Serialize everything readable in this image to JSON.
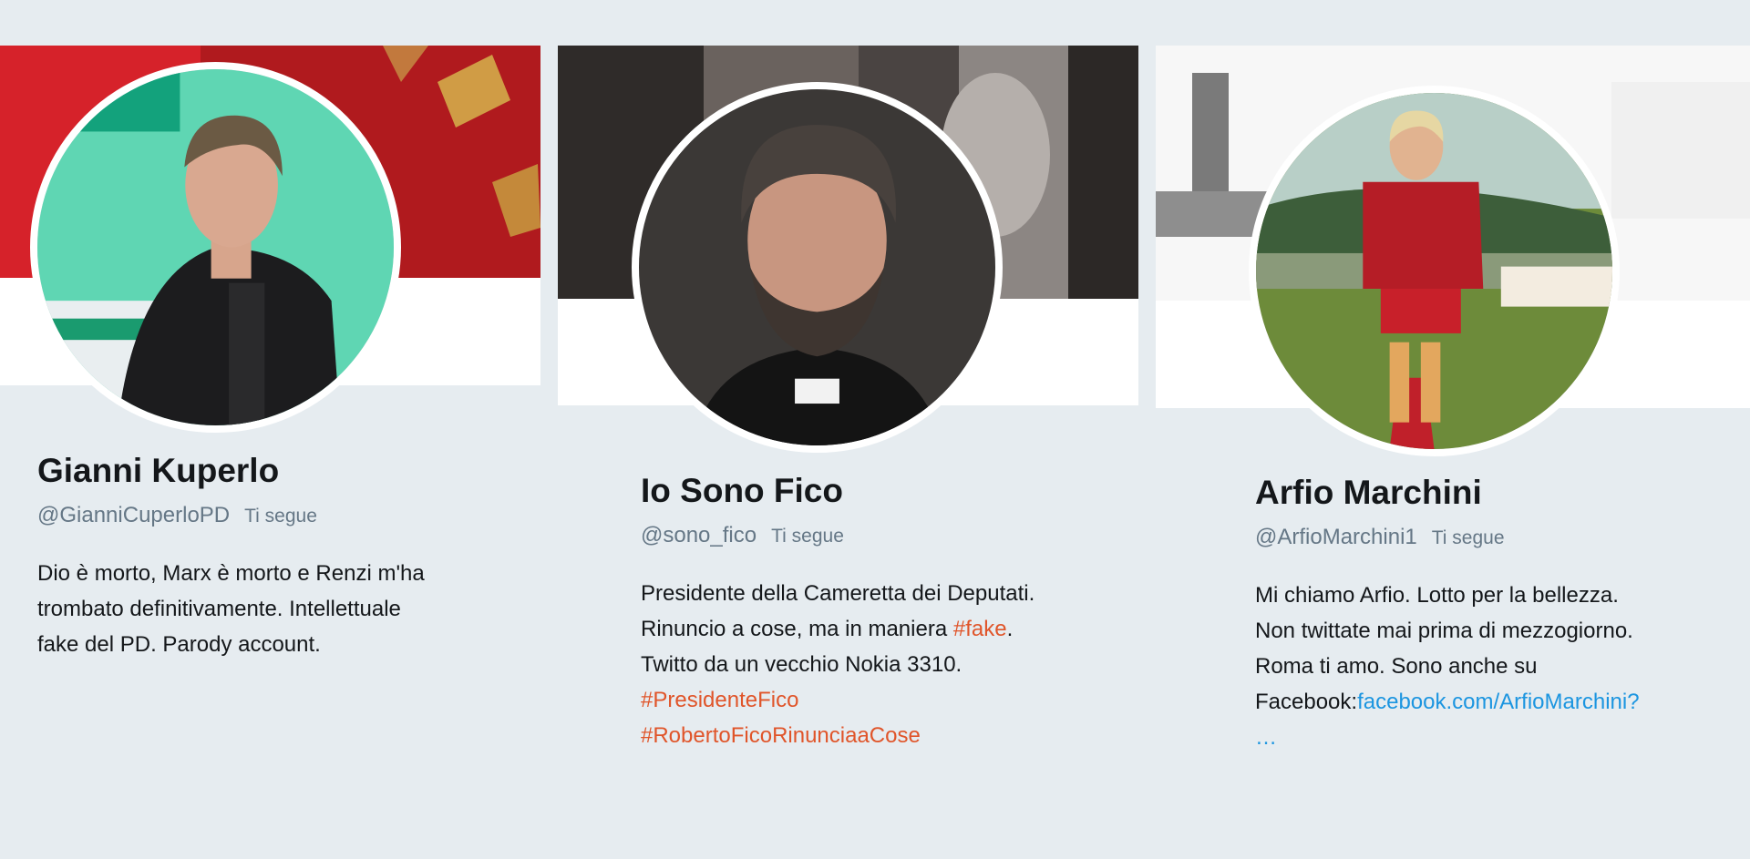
{
  "profiles": [
    {
      "name": "Gianni Kuperlo",
      "handle": "@GianniCuperloPD",
      "follows_you": "Ti segue",
      "bio_lines": [
        "Dio è morto, Marx è morto e Renzi m'ha",
        "trombato definitivamente. Intellettuale",
        "fake del PD. Parody account."
      ]
    },
    {
      "name": "Io Sono Fico",
      "handle": "@sono_fico",
      "follows_you": "Ti segue",
      "bio_lines": [
        "Presidente della Cameretta dei Deputati.",
        "Rinuncio a cose, ma in maniera ",
        "Twitto da un vecchio Nokia 3310."
      ],
      "bio_hashtag_inline": "#fake",
      "bio_period": ".",
      "hashtags": [
        "#PresidenteFico",
        "#RobertoFicoRinunciaaCose"
      ]
    },
    {
      "name": "Arfio Marchini",
      "handle": "@ArfioMarchini1",
      "follows_you": "Ti segue",
      "bio_lines": [
        "Mi chiamo Arfio. Lotto per la bellezza.",
        "Non twittate mai prima di mezzogiorno.",
        "Roma ti amo. Sono anche su"
      ],
      "bio_link_prefix": "Facebook:",
      "bio_link": "facebook.com/ArfioMarchini?",
      "bio_link_ellipsis": "…"
    }
  ],
  "colors": {
    "background": "#e6ecf0",
    "hashtag": "#e0552a",
    "link": "#1b95e0",
    "secondary_text": "#657786"
  },
  "images": {
    "avatar_1": "man-with-laptop-photo",
    "avatar_2": "bearded-man-clerical-collar-photo",
    "avatar_3": "boy-football-kit-photo"
  }
}
